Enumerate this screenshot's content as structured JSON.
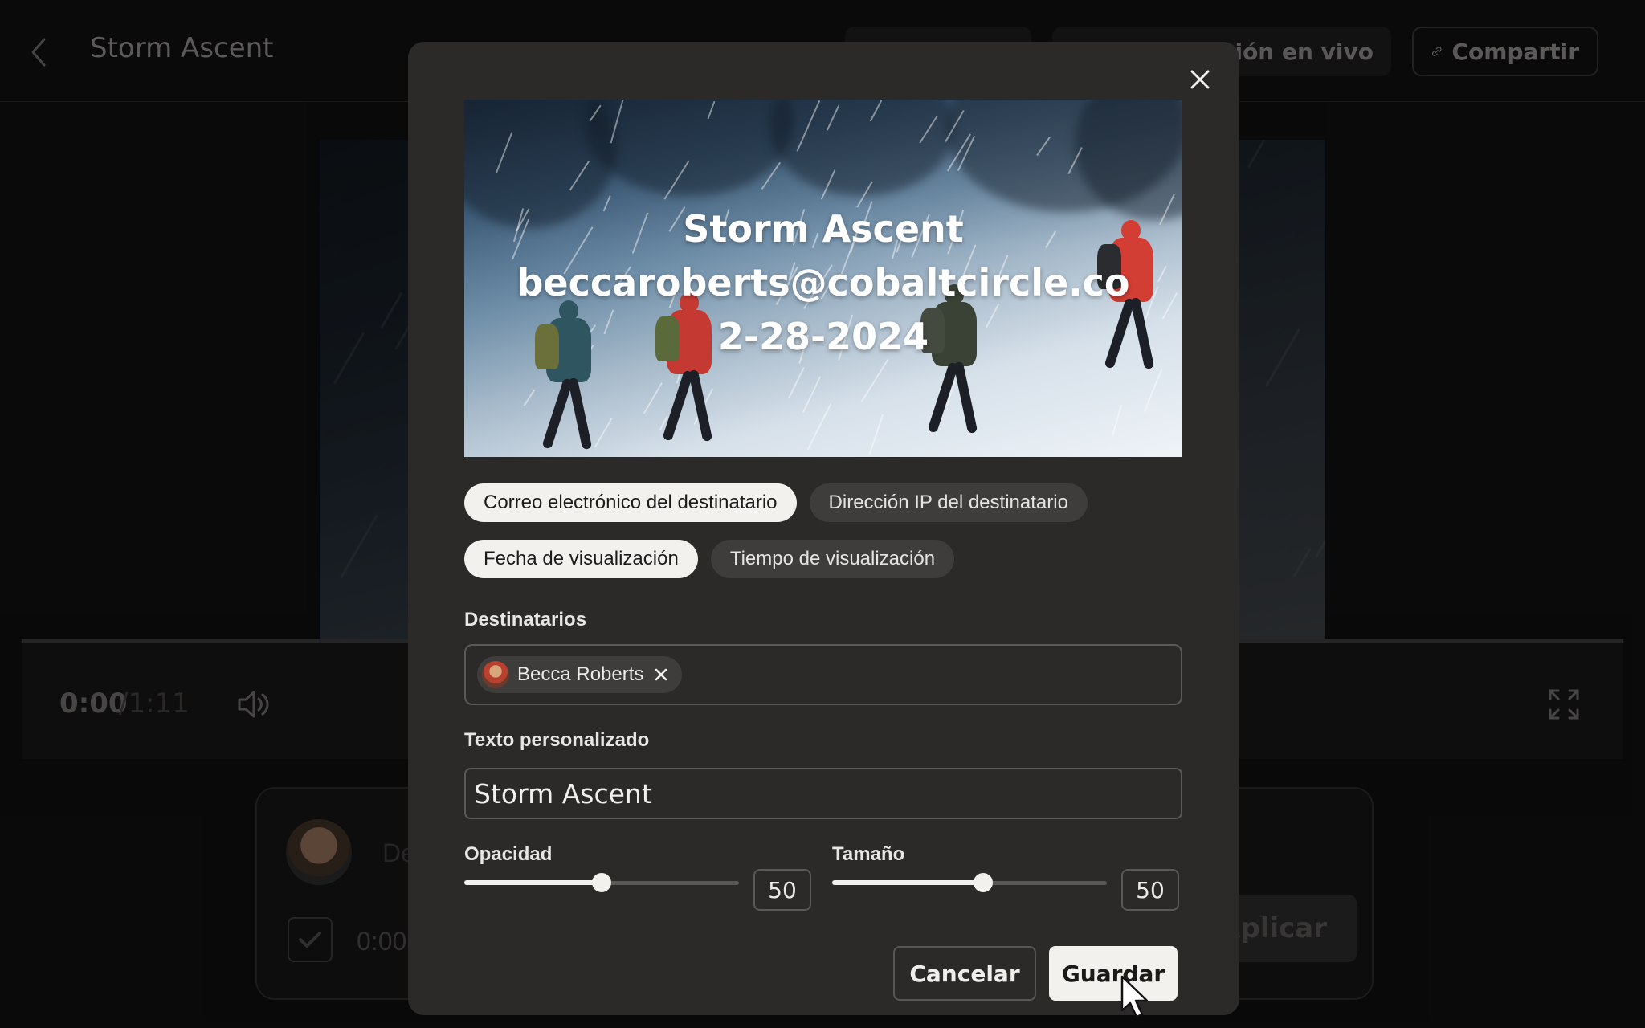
{
  "header": {
    "title": "Storm Ascent",
    "live_review_label": "Revisión en vivo",
    "share_label": "Compartir"
  },
  "player": {
    "current_time": "0:00",
    "duration": "/1:11"
  },
  "comment": {
    "placeholder": "De",
    "timestamp": "0:00",
    "apply_label": "Aplicar"
  },
  "modal": {
    "preview_lines": [
      "Storm Ascent",
      "beccaroberts@cobaltcircle.co",
      "2-28-2024"
    ],
    "chips": [
      {
        "label": "Correo electrónico del destinatario",
        "active": true
      },
      {
        "label": "Dirección IP del destinatario",
        "active": false
      },
      {
        "label": "Fecha de visualización",
        "active": true
      },
      {
        "label": "Tiempo de visualización",
        "active": false
      }
    ],
    "recipients_label": "Destinatarios",
    "recipients": [
      {
        "name": "Becca Roberts"
      }
    ],
    "custom_text_label": "Texto personalizado",
    "custom_text_value": "Storm Ascent",
    "opacity_label": "Opacidad",
    "opacity_value": "50",
    "opacity_fraction": 0.5,
    "size_label": "Tamaño",
    "size_value": "50",
    "size_fraction": 0.55,
    "cancel_label": "Cancelar",
    "save_label": "Guardar"
  },
  "colors": {
    "modal_bg": "#2b2a29",
    "chip_active": "#f3f1ed",
    "chip_inactive": "#3e3d3b"
  }
}
